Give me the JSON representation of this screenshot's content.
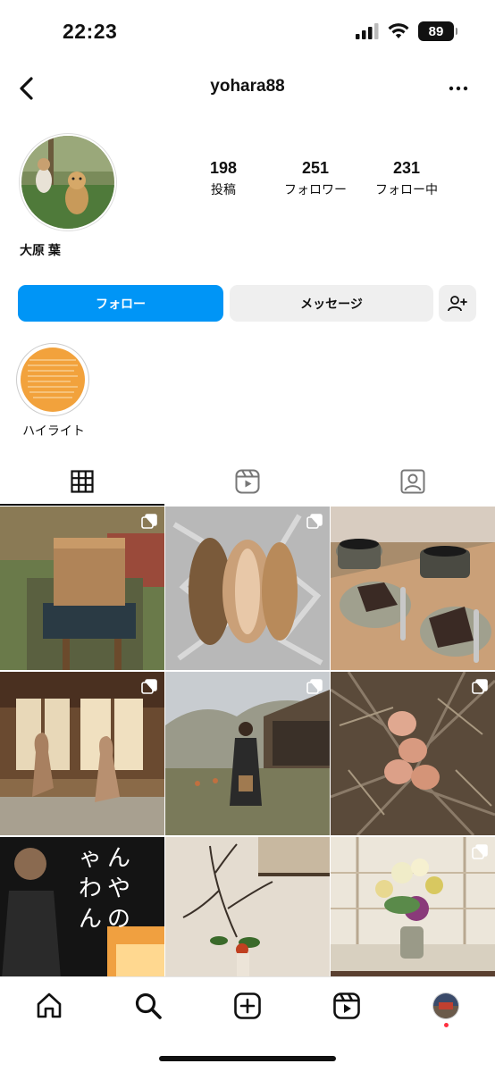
{
  "status_bar": {
    "time": "22:23",
    "battery": "89"
  },
  "header": {
    "username": "yohara88"
  },
  "profile": {
    "display_name": "大原 葉",
    "stats": [
      {
        "value": "198",
        "label": "投稿"
      },
      {
        "value": "251",
        "label": "フォロワー"
      },
      {
        "value": "231",
        "label": "フォロー中"
      }
    ]
  },
  "actions": {
    "follow_label": "フォロー",
    "message_label": "メッセージ"
  },
  "highlights": [
    {
      "label": "ハイライト"
    }
  ],
  "tabs": [
    {
      "icon": "grid-icon"
    },
    {
      "icon": "reels-icon"
    },
    {
      "icon": "tagged-icon"
    }
  ],
  "posts": [
    {
      "subject": "wooden box on stand in garden",
      "multi": true
    },
    {
      "subject": "roast pork on foil",
      "multi": true
    },
    {
      "subject": "coffee cups and cake on tray",
      "multi": false
    },
    {
      "subject": "dogs at window",
      "multi": true
    },
    {
      "subject": "woman in kimono in yard",
      "multi": true
    },
    {
      "subject": "brown eggs in leaves",
      "multi": true
    },
    {
      "subject": "book cover with craftsman",
      "multi": false
    },
    {
      "subject": "ikebana branch arrangement",
      "multi": false
    },
    {
      "subject": "flower arrangement by shoji",
      "multi": true
    }
  ],
  "bottom_nav": [
    {
      "icon": "home-icon"
    },
    {
      "icon": "search-icon"
    },
    {
      "icon": "create-icon"
    },
    {
      "icon": "reels-icon"
    },
    {
      "icon": "profile-avatar"
    }
  ],
  "colors": {
    "follow_button": "#0095f6",
    "secondary_button": "#efefef",
    "notification_dot": "#ff3040"
  }
}
